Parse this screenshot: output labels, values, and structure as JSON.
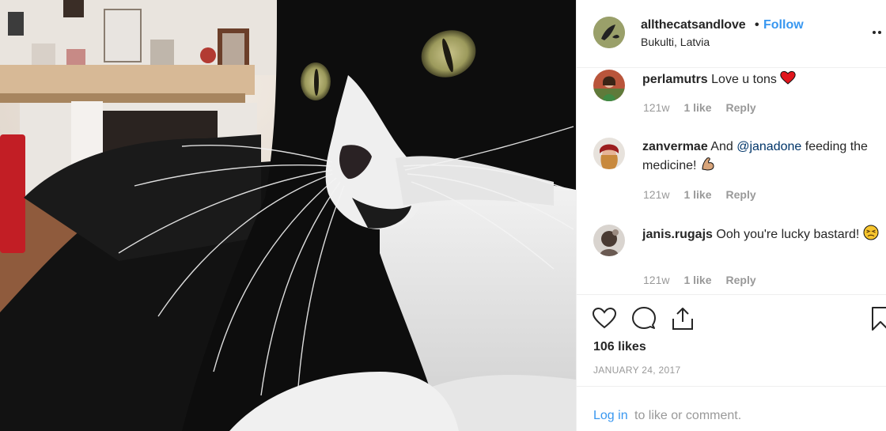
{
  "post": {
    "username": "allthecatsandlove",
    "separator": "•",
    "follow_label": "Follow",
    "location": "Bukulti, Latvia",
    "photo_subject": "black-and-white cat",
    "likes_text": "106 likes",
    "date": "JANUARY 24, 2017"
  },
  "comments": [
    {
      "user": "perlamutrs",
      "text_before": "Love u tons",
      "mention": "",
      "text_after": "",
      "emoji": "red-heart",
      "age": "121w",
      "likes": "1 like",
      "reply": "Reply"
    },
    {
      "user": "zanvermae",
      "text_before": "And",
      "mention": "@janadone",
      "text_after": "feeding the medicine!",
      "emoji": "flexed-biceps",
      "age": "121w",
      "likes": "1 like",
      "reply": "Reply"
    },
    {
      "user": "janis.rugajs",
      "text_before": "Ooh you're lucky bastard!",
      "mention": "",
      "text_after": "",
      "emoji": "persevering-face",
      "age": "121w",
      "likes": "1 like",
      "reply": "Reply"
    }
  ],
  "actions": {
    "icons": [
      "heart-icon",
      "comment-icon",
      "share-icon",
      "bookmark-icon"
    ]
  },
  "footer": {
    "login_label": "Log in",
    "rest_text": "to like or comment."
  },
  "colors": {
    "link_blue": "#3897f0",
    "mention_blue": "#003569",
    "meta_gray": "#999999",
    "divider": "#efefef"
  }
}
